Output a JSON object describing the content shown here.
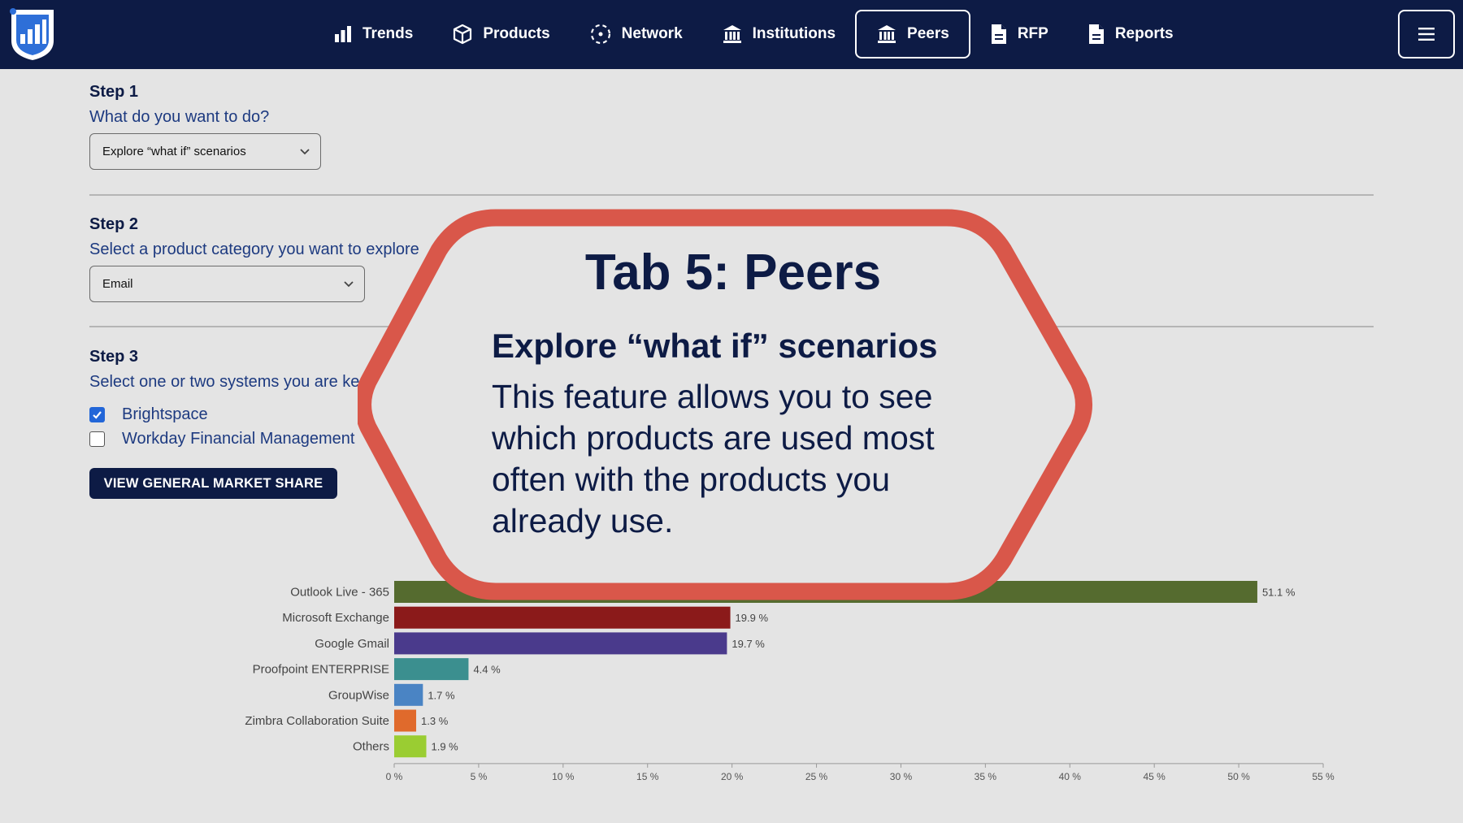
{
  "nav": {
    "items": [
      {
        "label": "Trends",
        "icon": "bar-chart-icon"
      },
      {
        "label": "Products",
        "icon": "cube-icon"
      },
      {
        "label": "Network",
        "icon": "network-icon"
      },
      {
        "label": "Institutions",
        "icon": "institution-icon"
      },
      {
        "label": "Peers",
        "icon": "institution-icon",
        "active": true
      },
      {
        "label": "RFP",
        "icon": "document-icon"
      },
      {
        "label": "Reports",
        "icon": "document-icon"
      }
    ],
    "menu_icon": "hamburger-icon"
  },
  "step1": {
    "title": "Step 1",
    "question": "What do you want to do?",
    "selected": "Explore “what if” scenarios"
  },
  "step2": {
    "title": "Step 2",
    "question": "Select a product category you want to explore",
    "selected": "Email"
  },
  "step3": {
    "title": "Step 3",
    "question": "Select one or two systems you are ke",
    "options": [
      {
        "label": "Brightspace",
        "checked": true
      },
      {
        "label": "Workday Financial Management",
        "checked": false
      }
    ]
  },
  "market_button": "VIEW GENERAL MARKET SHARE",
  "overlay": {
    "title": "Tab 5: Peers",
    "subtitle": "Explore “what if” scenarios",
    "body": "This feature allows you to see which products are used most often with the products you already use.",
    "border_color": "#d9574a"
  },
  "chart_data": {
    "type": "bar",
    "orientation": "horizontal",
    "categories": [
      "Outlook Live - 365",
      "Microsoft Exchange",
      "Google Gmail",
      "Proofpoint ENTERPRISE",
      "GroupWise",
      "Zimbra Collaboration Suite",
      "Others"
    ],
    "values": [
      51.1,
      19.9,
      19.7,
      4.4,
      1.7,
      1.3,
      1.9
    ],
    "value_labels": [
      "51.1 %",
      "19.9 %",
      "19.7 %",
      "4.4 %",
      "1.7 %",
      "1.3 %",
      "1.9 %"
    ],
    "colors": [
      "#556b2f",
      "#8b1a1a",
      "#4a3a8c",
      "#3b8f8f",
      "#4a84c4",
      "#e06a2c",
      "#9acd32"
    ],
    "xlim": [
      0,
      55
    ],
    "x_ticks": [
      "0 %",
      "5 %",
      "10 %",
      "15 %",
      "20 %",
      "25 %",
      "30 %",
      "35 %",
      "40 %",
      "45 %",
      "50 %",
      "55 %"
    ],
    "title": "",
    "xlabel": "",
    "ylabel": ""
  }
}
